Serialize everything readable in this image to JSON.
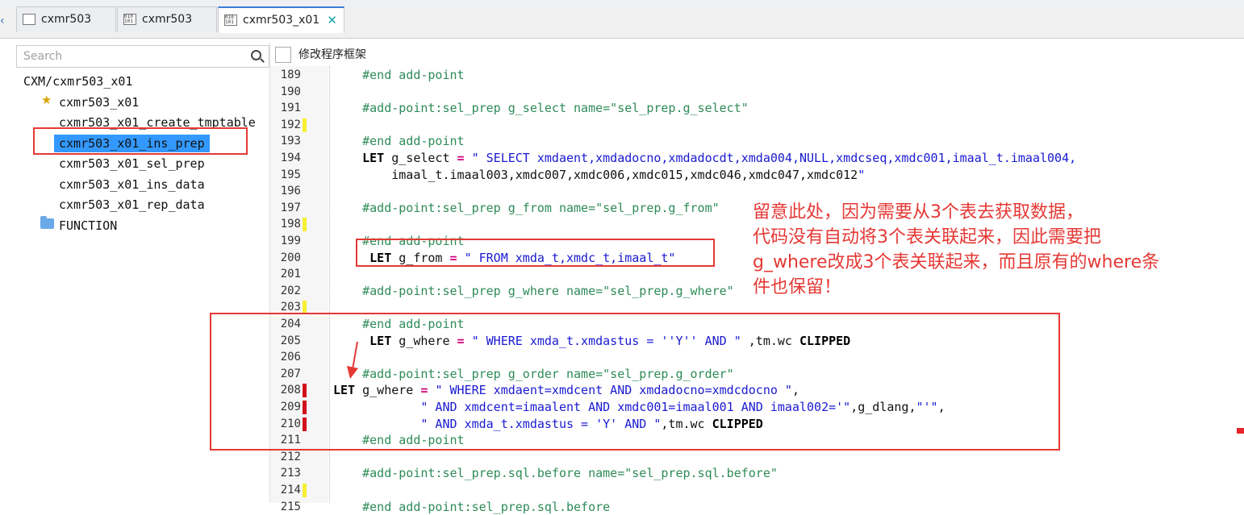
{
  "tabs": [
    {
      "label": "cxmr503",
      "icon": "form-icon",
      "active": false
    },
    {
      "label": "cxmr503",
      "icon": "binary-file-icon",
      "active": false
    },
    {
      "label": "cxmr503_x01",
      "icon": "binary-file-icon",
      "active": true
    }
  ],
  "sidebar": {
    "search_placeholder": "Search",
    "root": "CXM/cxmr503_x01",
    "items": [
      {
        "label": "cxmr503_x01",
        "icon": "star-icon"
      },
      {
        "label": "cxmr503_x01_create_tmptable"
      },
      {
        "label": "cxmr503_x01_ins_prep",
        "selected": true
      },
      {
        "label": "cxmr503_x01_sel_prep"
      },
      {
        "label": "cxmr503_x01_ins_data"
      },
      {
        "label": "cxmr503_x01_rep_data"
      },
      {
        "label": "FUNCTION",
        "icon": "folder-icon"
      }
    ]
  },
  "editor": {
    "checkbox_label": "修改程序框架",
    "lines": [
      {
        "n": "189",
        "mark": "",
        "text": "    #end add-point"
      },
      {
        "n": "190",
        "mark": "",
        "text": ""
      },
      {
        "n": "191",
        "mark": "",
        "text": "    #add-point:sel_prep g_select name=\"sel_prep.g_select\""
      },
      {
        "n": "192",
        "mark": "y",
        "text": ""
      },
      {
        "n": "193",
        "mark": "",
        "text": "    #end add-point"
      },
      {
        "n": "194",
        "mark": "",
        "text": "    LET g_select = \" SELECT xmdaent,xmdadocno,xmdadocdt,xmda004,NULL,xmdcseq,xmdc001,imaal_t.imaal004,"
      },
      {
        "n": "195",
        "mark": "",
        "text": "        imaal_t.imaal003,xmdc007,xmdc006,xmdc015,xmdc046,xmdc047,xmdc012\""
      },
      {
        "n": "196",
        "mark": "",
        "text": ""
      },
      {
        "n": "197",
        "mark": "",
        "text": "    #add-point:sel_prep g_from name=\"sel_prep.g_from\""
      },
      {
        "n": "198",
        "mark": "y",
        "text": ""
      },
      {
        "n": "199",
        "mark": "",
        "text": "    #end add-point"
      },
      {
        "n": "200",
        "mark": "",
        "text": "     LET g_from = \" FROM xmda_t,xmdc_t,imaal_t\""
      },
      {
        "n": "201",
        "mark": "",
        "text": ""
      },
      {
        "n": "202",
        "mark": "",
        "text": "    #add-point:sel_prep g_where name=\"sel_prep.g_where\""
      },
      {
        "n": "203",
        "mark": "y",
        "text": ""
      },
      {
        "n": "204",
        "mark": "",
        "text": "    #end add-point"
      },
      {
        "n": "205",
        "mark": "",
        "text": "     LET g_where = \" WHERE xmda_t.xmdastus = ''Y'' AND \" ,tm.wc CLIPPED"
      },
      {
        "n": "206",
        "mark": "",
        "text": ""
      },
      {
        "n": "207",
        "mark": "",
        "text": "    #add-point:sel_prep g_order name=\"sel_prep.g_order\""
      },
      {
        "n": "208",
        "mark": "r",
        "text": "LET g_where = \" WHERE xmdaent=xmdcent AND xmdadocno=xmdcdocno \","
      },
      {
        "n": "209",
        "mark": "r",
        "text": "            \" AND xmdcent=imaalent AND xmdc001=imaal001 AND imaal002='\",g_dlang,\"'\","
      },
      {
        "n": "210",
        "mark": "r",
        "text": "            \" AND xmda_t.xmdastus = 'Y' AND \",tm.wc CLIPPED"
      },
      {
        "n": "211",
        "mark": "",
        "text": "    #end add-point"
      },
      {
        "n": "212",
        "mark": "",
        "text": ""
      },
      {
        "n": "213",
        "mark": "",
        "text": "    #add-point:sel_prep.sql.before name=\"sel_prep.sql.before\""
      },
      {
        "n": "214",
        "mark": "y",
        "text": ""
      },
      {
        "n": "215",
        "mark": "",
        "text": "    #end add-point:sel_prep.sql.before"
      }
    ]
  },
  "annotation": {
    "lines": [
      "留意此处，因为需要从3个表去获取数据，",
      "代码没有自动将3个表关联起来，因此需要把",
      "g_where改成3个表关联起来，而且原有的where条",
      "件也保留！"
    ],
    "color": "#e53935"
  }
}
